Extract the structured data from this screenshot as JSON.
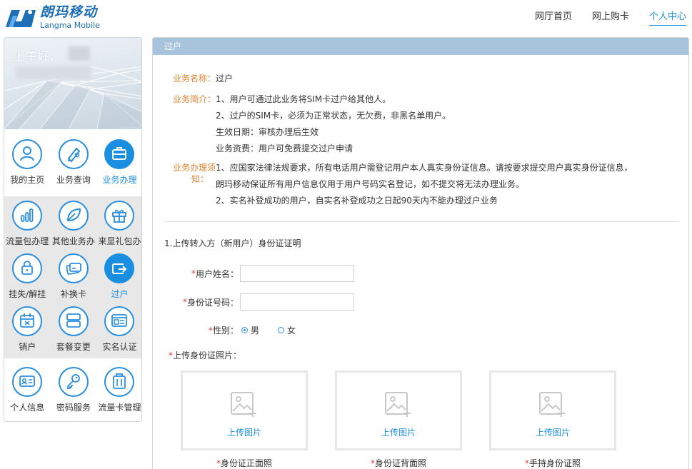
{
  "logo": {
    "cn": "朗玛移动",
    "en": "Langma Mobile"
  },
  "topnav": [
    {
      "label": "网厅首页"
    },
    {
      "label": "网上购卡"
    },
    {
      "label": "个人中心",
      "active": true
    }
  ],
  "sidebar": {
    "greeting": "上午好，",
    "top_items": [
      {
        "label": "我的主页",
        "icon": "user-icon"
      },
      {
        "label": "业务查询",
        "icon": "pen-icon"
      },
      {
        "label": "业务办理",
        "icon": "briefcase-icon",
        "selected": true
      }
    ],
    "sub_items": [
      {
        "label": "流量包办理",
        "icon": "bars-icon"
      },
      {
        "label": "其他业务办",
        "icon": "leaf-icon"
      },
      {
        "label": "来显礼包办",
        "icon": "gift-icon"
      },
      {
        "label": "挂失/解挂",
        "icon": "lock-icon"
      },
      {
        "label": "补换卡",
        "icon": "card-icon"
      },
      {
        "label": "过户",
        "icon": "transfer-icon",
        "selected": true
      },
      {
        "label": "销户",
        "icon": "calendar-x-icon"
      },
      {
        "label": "套餐变更",
        "icon": "package-icon"
      },
      {
        "label": "实名认证",
        "icon": "id-window-icon"
      }
    ],
    "bottom_items": [
      {
        "label": "个人信息",
        "icon": "id-card-icon"
      },
      {
        "label": "密码服务",
        "icon": "key-icon"
      },
      {
        "label": "流量卡管理",
        "icon": "sim-icon"
      }
    ]
  },
  "main": {
    "title": "过户",
    "info": {
      "name_key": "业务名称：",
      "name_val": "过户",
      "intro_key": "业务简介：",
      "intro_lines": [
        "1、用户可通过此业务将SIM卡过户给其他人。",
        "2、过户的SIM卡，必须为正常状态，无欠费，非黑名单用户。",
        "生效日期：审核办理后生效",
        "业务资费：用户可免费提交过户申请"
      ],
      "notice_key_1": "业务办理须",
      "notice_key_2": "知：",
      "notice_lines": [
        "1、应国家法律法规要求，所有电话用户需登记用户本人真实身份证信息。请按要求提交用户真实身份证信息，",
        "朗玛移动保证所有用户信息仅用于用户号码实名登记，如不提交将无法办理业务。",
        "2、实名补登成功的用户，自实名补登成功之日起90天内不能办理过户业务"
      ]
    },
    "form": {
      "section_title": "1.上传转入方（新用户）身份证证明",
      "required_mark": "*",
      "name_label": "用户姓名：",
      "name_value": "",
      "id_label": "身份证号码：",
      "id_value": "",
      "gender_label": "性别：",
      "gender_male": "男",
      "gender_female": "女",
      "gender_selected": "男",
      "photo_label": "上传身份证照片：",
      "upload_text": "上传图片",
      "captions": [
        "身份证正面照",
        "身份证背面照",
        "手持身份证照"
      ]
    }
  },
  "colors": {
    "accent": "#1a8ee0",
    "label_orange": "#e2822f",
    "required_red": "#e03b3b",
    "header_bar": "#a8c4dc"
  }
}
